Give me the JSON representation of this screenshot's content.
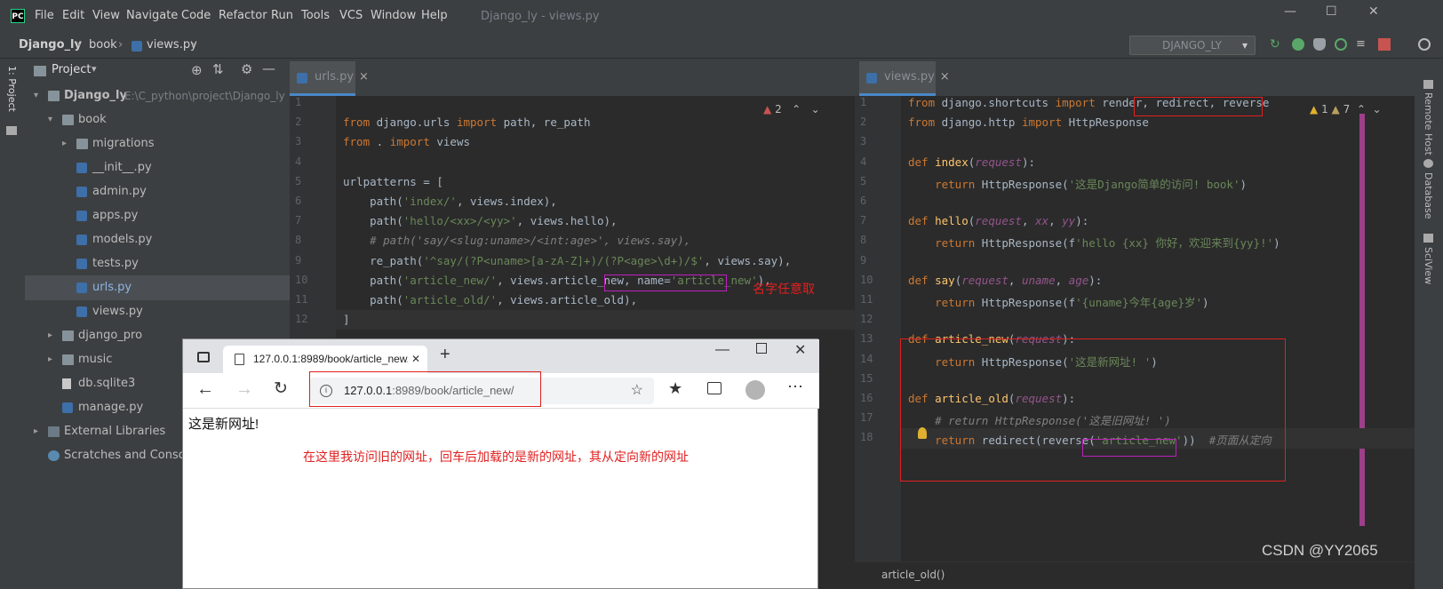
{
  "app": {
    "logo": "PC",
    "menu": [
      "File",
      "Edit",
      "View",
      "Navigate",
      "Code",
      "Refactor",
      "Run",
      "Tools",
      "VCS",
      "Window",
      "Help"
    ],
    "window_title": "Django_ly - views.py",
    "breadcrumb": [
      "Django_ly",
      "book",
      "views.py"
    ],
    "run_config": "DJANGO_LY"
  },
  "project": {
    "title": "Project",
    "tree": [
      {
        "label": "Django_ly",
        "hint": "E:\\C_python\\project\\Django_ly",
        "type": "folder",
        "arrow": "v",
        "bold": true
      },
      {
        "label": "book",
        "type": "folder",
        "arrow": "v"
      },
      {
        "label": "migrations",
        "type": "folder",
        "arrow": ">"
      },
      {
        "label": "__init__.py",
        "type": "py"
      },
      {
        "label": "admin.py",
        "type": "py"
      },
      {
        "label": "apps.py",
        "type": "py"
      },
      {
        "label": "models.py",
        "type": "py"
      },
      {
        "label": "tests.py",
        "type": "py"
      },
      {
        "label": "urls.py",
        "type": "py",
        "selected": true
      },
      {
        "label": "views.py",
        "type": "py"
      },
      {
        "label": "django_pro",
        "type": "folder",
        "arrow": ">"
      },
      {
        "label": "music",
        "type": "folder",
        "arrow": ">"
      },
      {
        "label": "db.sqlite3",
        "type": "file"
      },
      {
        "label": "manage.py",
        "type": "py"
      },
      {
        "label": "External Libraries",
        "type": "lib",
        "arrow": ">"
      },
      {
        "label": "Scratches and Consoles",
        "type": "scratch"
      }
    ],
    "left_tool_label": "1: Project"
  },
  "editor_left": {
    "tab": "urls.py",
    "warnings": "2",
    "line_numbers": [
      "1",
      "2",
      "3",
      "4",
      "5",
      "6",
      "7",
      "8",
      "9",
      "10",
      "11",
      "12"
    ],
    "lines": [
      "",
      "from django.urls import path, re_path",
      "from . import views",
      "",
      "urlpatterns = [",
      "    path('index/', views.index),",
      "    path('hello/<xx>/<yy>', views.hello),",
      "    # path('say/<slug:uname>/<int:age>', views.say),",
      "    re_path('^say/(?P<uname>[a-zA-Z]+)/(?P<age>\\d+)/$', views.say),",
      "    path('article_new/', views.article_new, name='article_new'),",
      "    path('article_old/', views.article_old),",
      "]"
    ]
  },
  "editor_right": {
    "tab": "views.py",
    "warnings": "1",
    "weak_warnings": "7",
    "line_numbers": [
      "1",
      "2",
      "3",
      "4",
      "5",
      "6",
      "7",
      "8",
      "9",
      "10",
      "11",
      "12",
      "13",
      "14",
      "15",
      "16",
      "17",
      "18"
    ],
    "lines": [
      "from django.shortcuts import render, redirect, reverse",
      "from django.http import HttpResponse",
      "",
      "def index(request):",
      "    return HttpResponse('这是Django简单的访问! book')",
      "",
      "def hello(request, xx, yy):",
      "    return HttpResponse(f'hello {xx} 你好，欢迎来到{yy}!')",
      "",
      "def say(request, uname, age):",
      "    return HttpResponse(f'{uname}今年{age}岁')",
      "",
      "def article_new(request):",
      "    return HttpResponse('这是新网址! ')",
      "",
      "def article_old(request):",
      "    # return HttpResponse('这是旧网址! ')",
      "    return redirect(reverse('article_new'))  #页面从定向"
    ],
    "status_func": "article_old()"
  },
  "browser": {
    "tab_title": "127.0.0.1:8989/book/article_new/",
    "url_host": "127.0.0.1",
    "url_rest": ":8989/book/article_new/",
    "page_text": "这是新网址!"
  },
  "annotations": {
    "name_note": "名字任意取",
    "browser_note": "在这里我访问旧的网址，回车后加载的是新的网址，其从定向新的网址"
  },
  "right_tools": [
    "Remote Host",
    "Database",
    "SciView"
  ],
  "watermark": "CSDN @YY2065",
  "colors": {
    "accent": "#4a88c7",
    "annotation": "#e02020",
    "highlight_box": "#c020c0"
  }
}
